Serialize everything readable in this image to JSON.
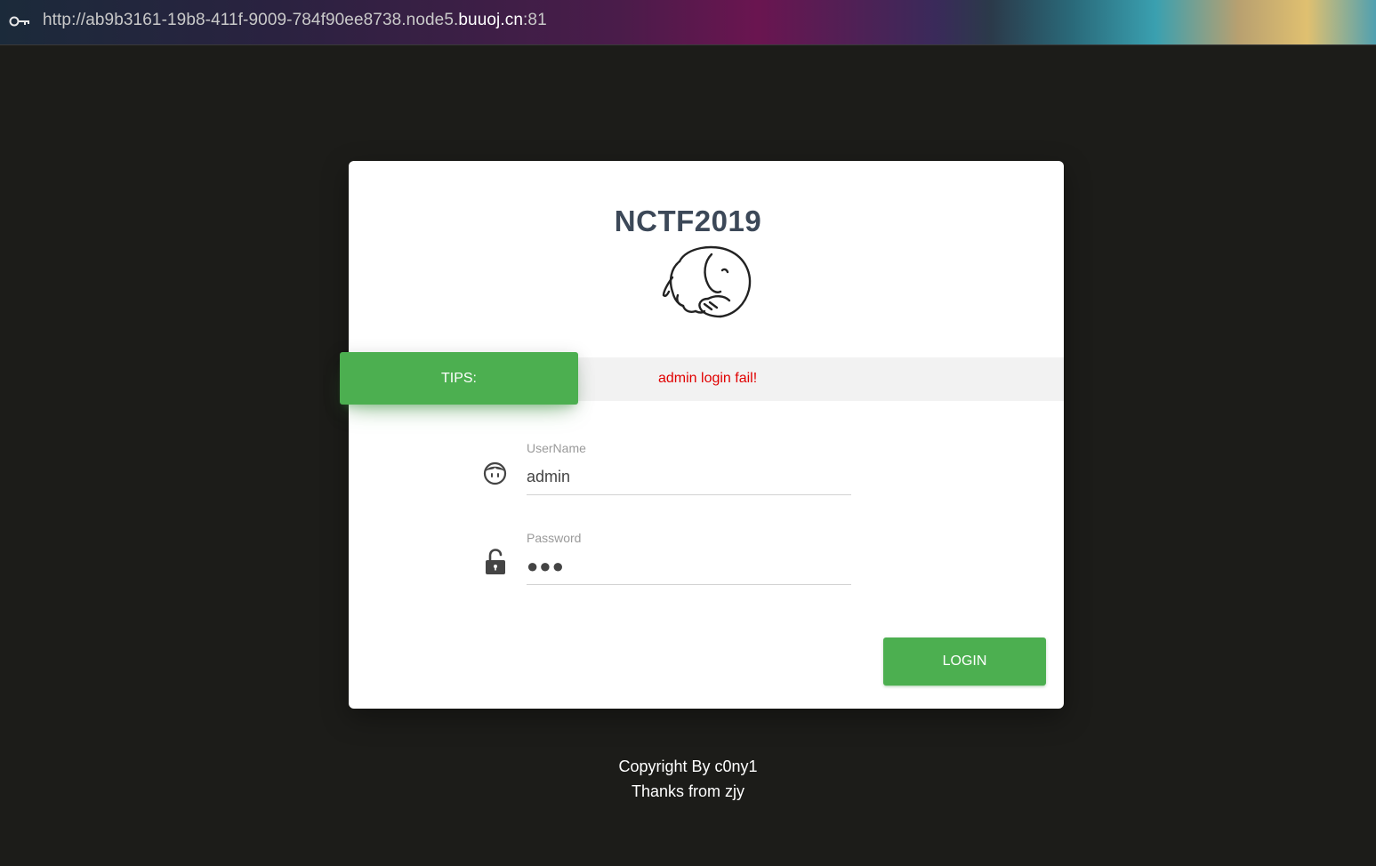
{
  "browser": {
    "url_prefix": "http://ab9b3161-19b8-411f-9009-784f90ee8738.node5.",
    "url_host": "buuoj.cn",
    "url_suffix": ":81",
    "icon": "key-icon"
  },
  "card": {
    "title": "NCTF2019",
    "logo_icon": "elephant-icon",
    "tips_label": "TIPS:",
    "tips_message": "admin login fail!",
    "username": {
      "label": "UserName",
      "value": "admin",
      "icon": "face-icon"
    },
    "password": {
      "label": "Password",
      "masked_value": "●●●",
      "icon": "unlock-icon"
    },
    "login_label": "LOGIN"
  },
  "footer": {
    "line1": "Copyright By c0ny1",
    "line2": "Thanks from zjy"
  },
  "colors": {
    "accent": "#4caf50",
    "error": "#e00000",
    "background": "#1c1c19",
    "title": "#3c4858"
  }
}
